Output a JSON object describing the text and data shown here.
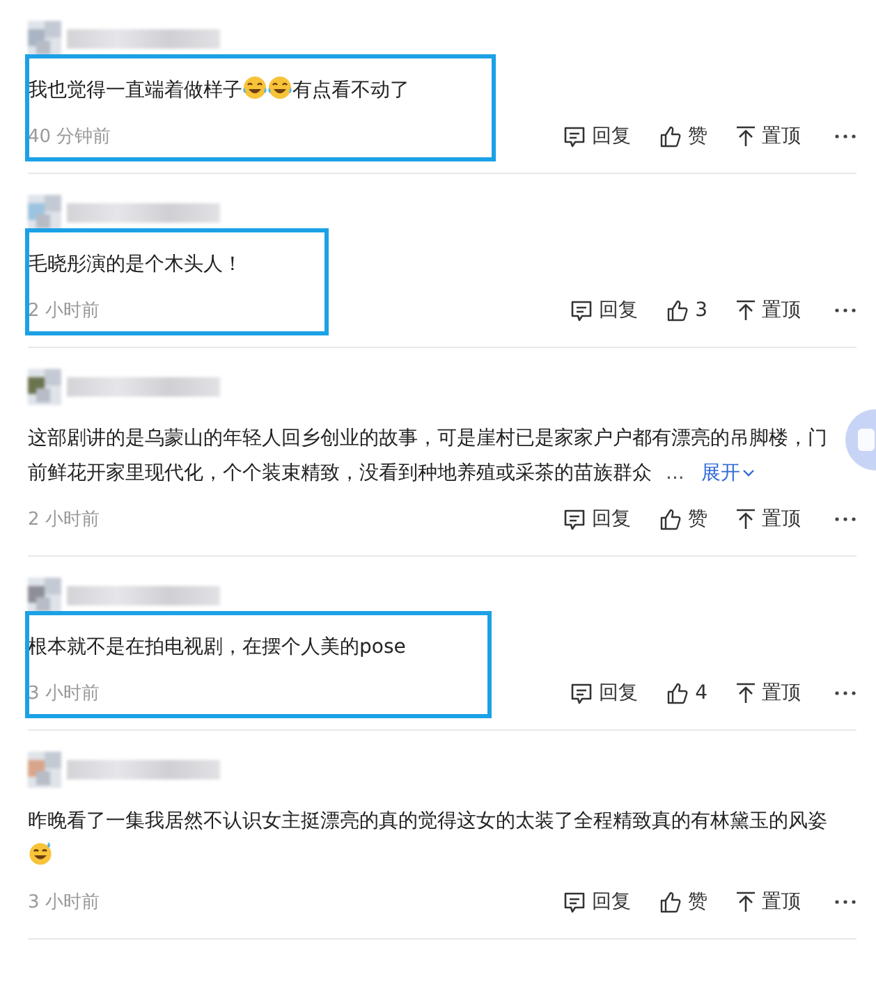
{
  "comments": [
    {
      "highlighted": true,
      "content": [
        {
          "kind": "text",
          "text": "我也觉得一直端着做样子"
        },
        {
          "kind": "tears-emoji"
        },
        {
          "kind": "tears-emoji"
        },
        {
          "kind": "text",
          "text": "有点看不动了"
        }
      ],
      "time": "40 分钟前",
      "reply": "回复",
      "like": "赞",
      "pin": "置顶"
    },
    {
      "highlighted": true,
      "content": [
        {
          "kind": "text",
          "text": "毛晓彤演的是个木头人！"
        }
      ],
      "time": "2 小时前",
      "reply": "回复",
      "like": "3",
      "pin": "置顶"
    },
    {
      "highlighted": false,
      "content": [
        {
          "kind": "text",
          "text": "这部剧讲的是乌蒙山的年轻人回乡创业的故事，可是崖村已是家家户户都有漂亮的吊脚楼，门前鲜花开家里现代化，个个装束精致，没看到种地养殖或采茶的苗族群众"
        }
      ],
      "ellipsis": "...",
      "expand": "展开",
      "time": "2 小时前",
      "reply": "回复",
      "like": "赞",
      "pin": "置顶"
    },
    {
      "highlighted": true,
      "content": [
        {
          "kind": "text",
          "text": "根本就不是在拍电视剧，在摆个人美的pose"
        }
      ],
      "time": "3 小时前",
      "reply": "回复",
      "like": "4",
      "pin": "置顶"
    },
    {
      "highlighted": false,
      "content": [
        {
          "kind": "text",
          "text": "昨晚看了一集我居然不认识女主挺漂亮的真的觉得这女的太装了全程精致真的有林黛玉的风姿"
        },
        {
          "kind": "sweat-emoji"
        }
      ],
      "time": "3 小时前",
      "reply": "回复",
      "like": "赞",
      "pin": "置顶"
    }
  ]
}
